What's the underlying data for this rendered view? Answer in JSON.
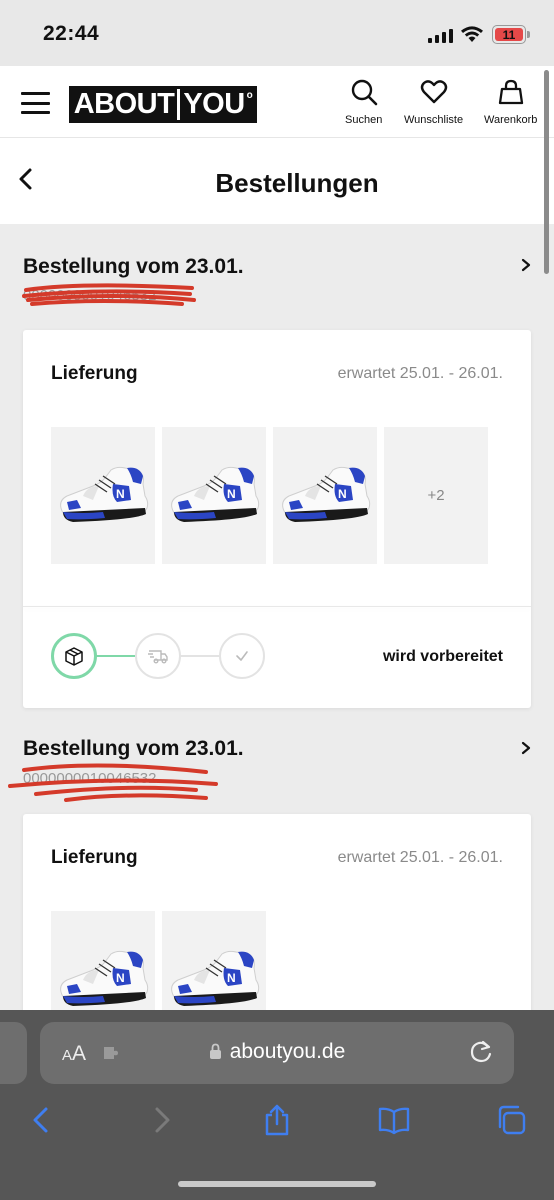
{
  "status_bar": {
    "time": "22:44",
    "battery": "11"
  },
  "header": {
    "logo_left": "ABOUT",
    "logo_right": "YOU",
    "actions": [
      {
        "label": "Suchen",
        "icon": "search-icon"
      },
      {
        "label": "Wunschliste",
        "icon": "heart-icon"
      },
      {
        "label": "Warenkorb",
        "icon": "bag-icon"
      }
    ]
  },
  "page": {
    "title": "Bestellungen"
  },
  "orders": [
    {
      "title": "Bestellung vom 23.01.",
      "number": "0000000001046532",
      "shipment": {
        "label": "Lieferung",
        "expected": "erwartet 25.01. - 26.01.",
        "extra_items": "+2",
        "status": "wird vorbereitet",
        "steps": [
          "package-icon",
          "truck-icon",
          "check-icon"
        ],
        "active_step": 1
      }
    },
    {
      "title": "Bestellung vom 23.01.",
      "number": "0000000010046532",
      "shipment": {
        "label": "Lieferung",
        "expected": "erwartet 25.01. - 26.01."
      }
    }
  ],
  "safari": {
    "text_size_small": "A",
    "text_size_large": "A",
    "url": "aboutyou.de"
  },
  "colors": {
    "accent_green": "#7fd8a8",
    "shoe_blue": "#2b45c4",
    "redact_red": "#d43a2a"
  }
}
